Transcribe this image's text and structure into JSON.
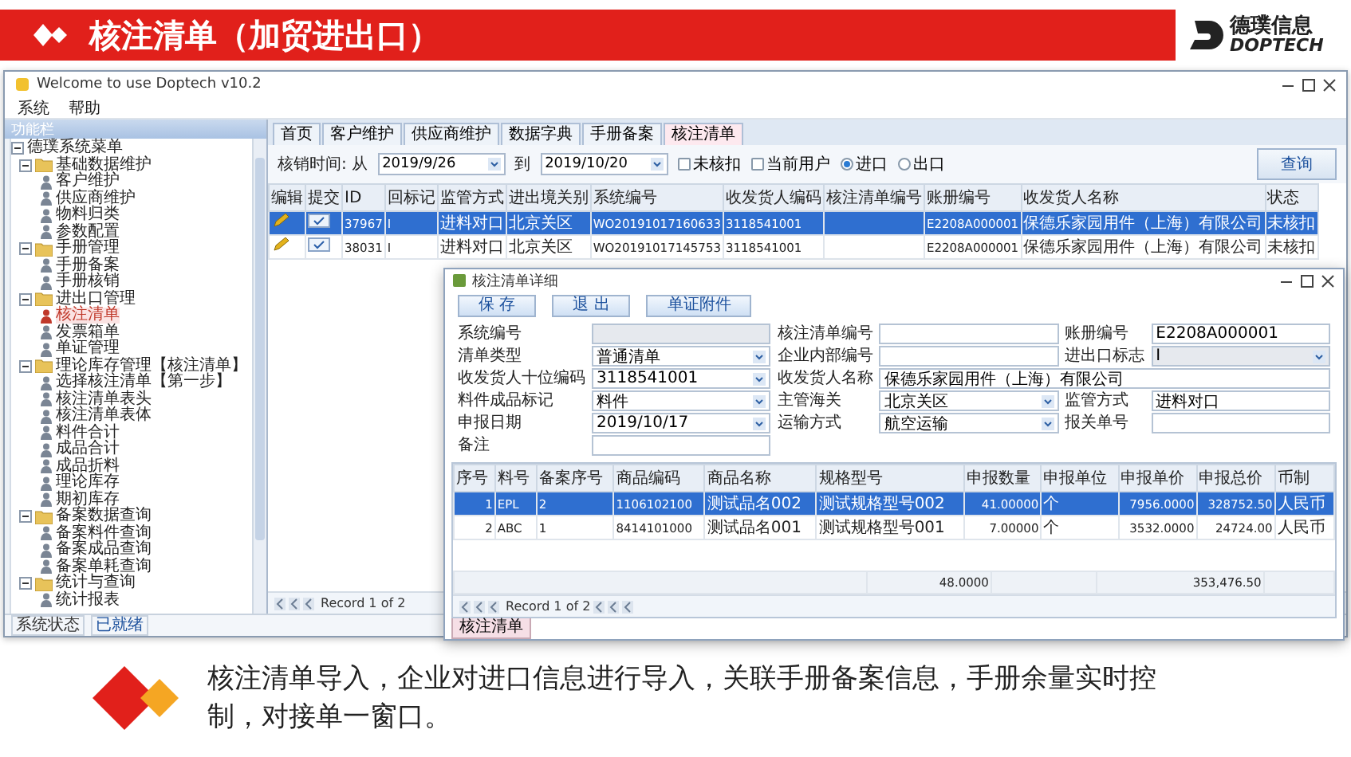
{
  "slide": {
    "title": "核注清单（加贸进出口）",
    "logo": {
      "cn": "德璞信息",
      "en": "DOPTECH"
    },
    "caption": "核注清单导入，企业对进口信息进行导入，关联手册备案信息，手册余量实时控制，对接单一窗口。"
  },
  "window": {
    "title": "Welcome to use Doptech v10.2",
    "menu": [
      "系统",
      "帮助"
    ],
    "sidebar": {
      "title": "功能栏",
      "tree": [
        {
          "label": "德璞系统菜单",
          "kind": "root",
          "expanded": true,
          "children": [
            {
              "label": "基础数据维护",
              "kind": "folder",
              "expanded": true,
              "children": [
                {
                  "label": "客户维护",
                  "kind": "leaf",
                  "selected": false
                },
                {
                  "label": "供应商维护",
                  "kind": "leaf",
                  "selected": false
                },
                {
                  "label": "物料归类",
                  "kind": "leaf",
                  "selected": false
                },
                {
                  "label": "参数配置",
                  "kind": "leaf",
                  "selected": false
                }
              ]
            },
            {
              "label": "手册管理",
              "kind": "folder",
              "expanded": true,
              "children": [
                {
                  "label": "手册备案",
                  "kind": "leaf",
                  "selected": false
                },
                {
                  "label": "手册核销",
                  "kind": "leaf",
                  "selected": false
                }
              ]
            },
            {
              "label": "进出口管理",
              "kind": "folder",
              "expanded": true,
              "children": [
                {
                  "label": "核注清单",
                  "kind": "leaf",
                  "selected": true
                },
                {
                  "label": "发票箱单",
                  "kind": "leaf",
                  "selected": false
                },
                {
                  "label": "单证管理",
                  "kind": "leaf",
                  "selected": false
                }
              ]
            },
            {
              "label": "理论库存管理【核注清单】",
              "kind": "folder",
              "expanded": true,
              "children": [
                {
                  "label": "选择核注清单【第一步】",
                  "kind": "leaf",
                  "selected": false
                },
                {
                  "label": "核注清单表头",
                  "kind": "leaf",
                  "selected": false
                },
                {
                  "label": "核注清单表体",
                  "kind": "leaf",
                  "selected": false
                },
                {
                  "label": "料件合计",
                  "kind": "leaf",
                  "selected": false
                },
                {
                  "label": "成品合计",
                  "kind": "leaf",
                  "selected": false
                },
                {
                  "label": "成品折料",
                  "kind": "leaf",
                  "selected": false
                },
                {
                  "label": "理论库存",
                  "kind": "leaf",
                  "selected": false
                },
                {
                  "label": "期初库存",
                  "kind": "leaf",
                  "selected": false
                }
              ]
            },
            {
              "label": "备案数据查询",
              "kind": "folder",
              "expanded": true,
              "children": [
                {
                  "label": "备案料件查询",
                  "kind": "leaf",
                  "selected": false
                },
                {
                  "label": "备案成品查询",
                  "kind": "leaf",
                  "selected": false
                },
                {
                  "label": "备案单耗查询",
                  "kind": "leaf",
                  "selected": false
                }
              ]
            },
            {
              "label": "统计与查询",
              "kind": "folder",
              "expanded": true,
              "children": [
                {
                  "label": "统计报表",
                  "kind": "leaf",
                  "selected": false
                }
              ]
            }
          ]
        }
      ]
    },
    "tabs": [
      {
        "label": "首页",
        "selected": false
      },
      {
        "label": "客户维护",
        "selected": false
      },
      {
        "label": "供应商维护",
        "selected": false
      },
      {
        "label": "数据字典",
        "selected": false
      },
      {
        "label": "手册备案",
        "selected": false
      },
      {
        "label": "核注清单",
        "selected": true
      }
    ],
    "filter": {
      "label": "核销时间: 从",
      "from": "2019/9/26",
      "to_label": "到",
      "to": "2019/10/20",
      "checks": [
        {
          "label": "未核扣",
          "checked": false
        },
        {
          "label": "当前用户",
          "checked": false
        }
      ],
      "radios": [
        {
          "label": "进口",
          "selected": true
        },
        {
          "label": "出口",
          "selected": false
        }
      ],
      "button": "查询"
    },
    "table": {
      "columns": [
        "编辑",
        "提交",
        "ID",
        "回标记",
        "监管方式",
        "进出境关别",
        "系统编号",
        "收发货人编码",
        "核注清单编号",
        "账册编号",
        "收发货人名称",
        "状态"
      ],
      "rows": [
        {
          "selected": true,
          "cells": [
            "",
            "",
            "37967",
            "I",
            "进料对口",
            "北京关区",
            "WO20191017160633",
            "3118541001",
            "",
            "E2208A000001",
            "保德乐家园用件（上海）有限公司",
            "未核扣"
          ]
        },
        {
          "selected": false,
          "cells": [
            "",
            "",
            "38031",
            "I",
            "进料对口",
            "北京关区",
            "WO20191017145753",
            "3118541001",
            "",
            "E2208A000001",
            "保德乐家园用件（上海）有限公司",
            "未核扣"
          ]
        }
      ]
    },
    "pager": "Record 1 of 2",
    "status_bar": [
      "系统状态",
      "已就绪"
    ]
  },
  "dialog": {
    "title": "核注清单详细",
    "buttons": [
      "保 存",
      "退 出",
      "单证附件"
    ],
    "fields": [
      {
        "label": "系统编号",
        "kind": "text",
        "disabled": true
      },
      {
        "label": "核注清单编号",
        "kind": "text"
      },
      {
        "label": "账册编号",
        "kind": "text",
        "value": "E2208A000001"
      },
      {
        "label": "清单类型",
        "kind": "select",
        "value": "普通清单"
      },
      {
        "label": "企业内部编号",
        "kind": "text"
      },
      {
        "label": "进出口标志",
        "kind": "select",
        "value": "I",
        "disabled": true
      },
      {
        "label": "收发货人十位编码",
        "kind": "select",
        "value": "3118541001"
      },
      {
        "label": "收发货人名称",
        "kind": "text",
        "value": "保德乐家园用件（上海）有限公司"
      },
      {
        "label": "料件成品标记",
        "kind": "select",
        "value": "料件"
      },
      {
        "label": "主管海关",
        "kind": "select",
        "value": "北京关区"
      },
      {
        "label": "监管方式",
        "kind": "text",
        "value": "进料对口"
      },
      {
        "label": "申报日期",
        "kind": "select",
        "value": "2019/10/17"
      },
      {
        "label": "运输方式",
        "kind": "select",
        "value": "航空运输"
      },
      {
        "label": "报关单号",
        "kind": "text"
      },
      {
        "label": "备注",
        "kind": "text"
      }
    ],
    "table": {
      "columns": [
        "序号",
        "料号",
        "备案序号",
        "商品编码",
        "商品名称",
        "规格型号",
        "申报数量",
        "申报单位",
        "申报单价",
        "申报总价",
        "币制"
      ],
      "rows": [
        {
          "selected": true,
          "cells": [
            "1",
            "EPL",
            "2",
            "1106102100",
            "测试品名002",
            "测试规格型号002",
            "41.00000",
            "个",
            "7956.0000",
            "328752.50",
            "人民币"
          ]
        },
        {
          "selected": false,
          "cells": [
            "2",
            "ABC",
            "1",
            "8414101000",
            "测试品名001",
            "测试规格型号001",
            "7.00000",
            "个",
            "3532.0000",
            "24724.00",
            "人民币"
          ]
        }
      ],
      "quantity_total": "48.0000",
      "amount_total": "353,476.50"
    },
    "pager": "Record 1 of 2",
    "tab": "核注清单"
  }
}
